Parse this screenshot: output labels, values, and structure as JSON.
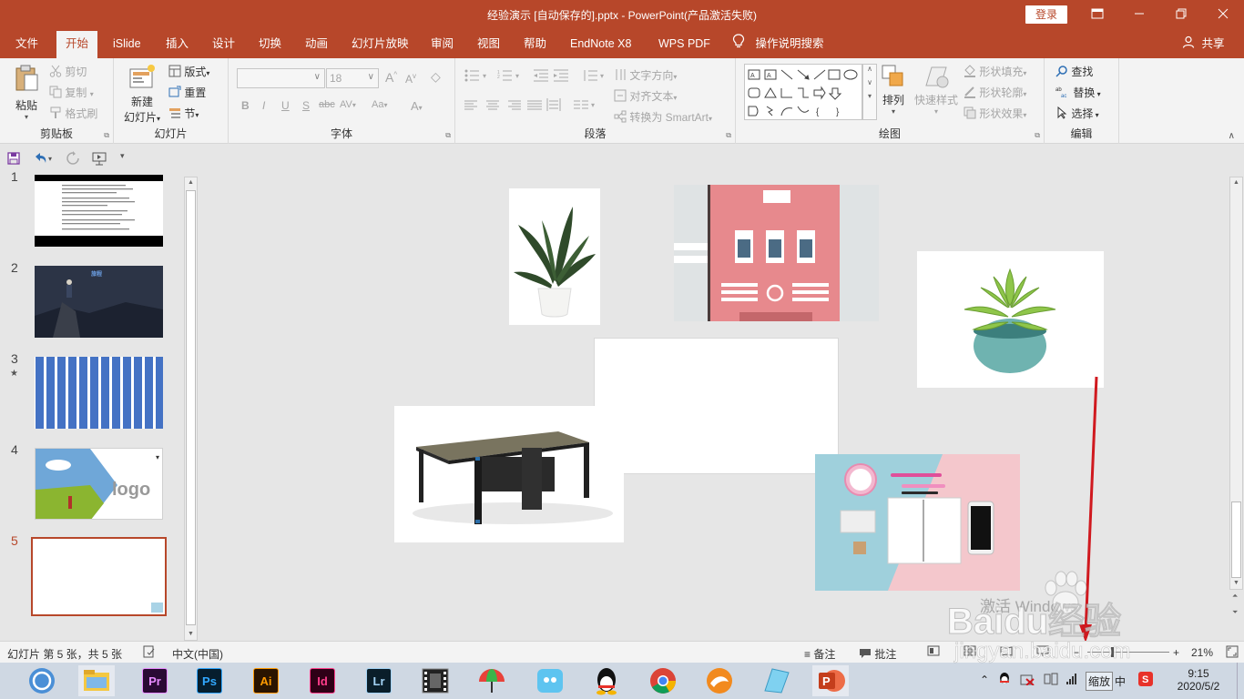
{
  "window": {
    "title": "经验演示 [自动保存的].pptx  -  PowerPoint(产品激活失败)",
    "login_label": "登录"
  },
  "tabs": [
    "文件",
    "开始",
    "iSlide",
    "插入",
    "设计",
    "切换",
    "动画",
    "幻灯片放映",
    "审阅",
    "视图",
    "帮助",
    "EndNote X8",
    "WPS PDF"
  ],
  "active_tab": "开始",
  "tell_me": "操作说明搜索",
  "share": "共享",
  "ribbon": {
    "clipboard": {
      "label": "剪贴板",
      "paste": "粘贴",
      "cut": "剪切",
      "copy": "复制",
      "format_painter": "格式刷"
    },
    "slides": {
      "label": "幻灯片",
      "new_slide_1": "新建",
      "new_slide_2": "幻灯片",
      "layout": "版式",
      "reset": "重置",
      "section": "节"
    },
    "font": {
      "label": "字体",
      "font_name": "",
      "font_size": "18"
    },
    "paragraph": {
      "label": "段落",
      "text_direction": "文字方向",
      "align_text": "对齐文本",
      "smartart": "转换为 SmartArt"
    },
    "drawing": {
      "label": "绘图",
      "arrange": "排列",
      "quick_styles": "快速样式",
      "shape_fill": "形状填充",
      "shape_outline": "形状轮廓",
      "shape_effects": "形状效果"
    },
    "editing": {
      "label": "编辑",
      "find": "查找",
      "replace": "替换",
      "select": "选择"
    }
  },
  "slides": [
    {
      "num": "1",
      "star": false
    },
    {
      "num": "2",
      "star": false
    },
    {
      "num": "3",
      "star": true
    },
    {
      "num": "4",
      "star": false
    },
    {
      "num": "5",
      "star": false,
      "selected": true
    }
  ],
  "star_glyph": "★",
  "thumb2_title": "旅程",
  "thumb4_logo": "logo",
  "status": {
    "slide_info": "幻灯片 第 5 张，共 5 张",
    "language": "中文(中国)",
    "notes": "备注",
    "comments": "批注",
    "zoom": "21%"
  },
  "activation_hint": "激活 Windows",
  "taskbar": {
    "apps": [
      "Pr",
      "Ps",
      "Ai",
      "Id",
      "Lr"
    ],
    "ime_mode": "中",
    "zoom_tray": "缩放",
    "time": "9:15",
    "date": "2020/5/2"
  },
  "watermark": {
    "brand": "Baidu经验",
    "url": "jingyan.baidu.com"
  },
  "colors": {
    "accent": "#b7472a",
    "ribbon_bg": "#f3f3f3",
    "annotation_arrow": "#d0191f"
  }
}
